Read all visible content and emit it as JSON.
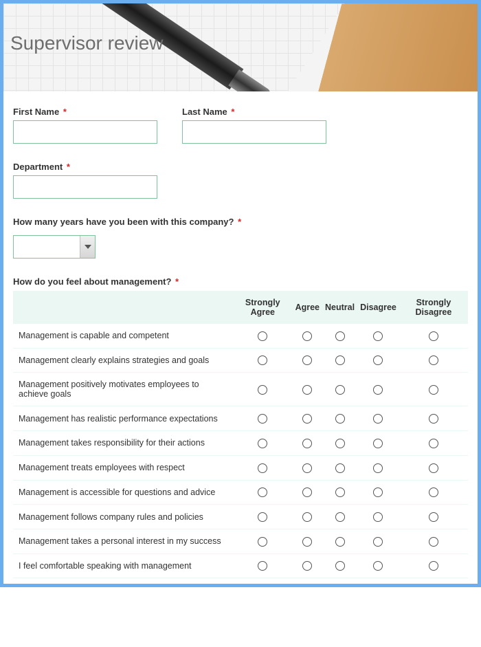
{
  "header": {
    "title": "Supervisor review"
  },
  "fields": {
    "first_name": {
      "label": "First Name",
      "required": "*",
      "value": ""
    },
    "last_name": {
      "label": "Last Name",
      "required": "*",
      "value": ""
    },
    "department": {
      "label": "Department",
      "required": "*",
      "value": ""
    },
    "years": {
      "label": "How many years have you been with this company?",
      "required": "*",
      "value": ""
    }
  },
  "matrix": {
    "question": "How do you feel about management?",
    "required": "*",
    "columns": [
      "Strongly Agree",
      "Agree",
      "Neutral",
      "Disagree",
      "Strongly Disagree"
    ],
    "rows": [
      "Management is capable and competent",
      "Management clearly explains strategies and goals",
      "Management positively motivates employees to achieve goals",
      "Management has realistic performance expectations",
      "Management takes responsibility for their actions",
      "Management treats employees with respect",
      "Management is accessible for questions and advice",
      "Management follows company rules and policies",
      "Management takes a personal interest in my success",
      "I feel comfortable speaking with management"
    ]
  }
}
